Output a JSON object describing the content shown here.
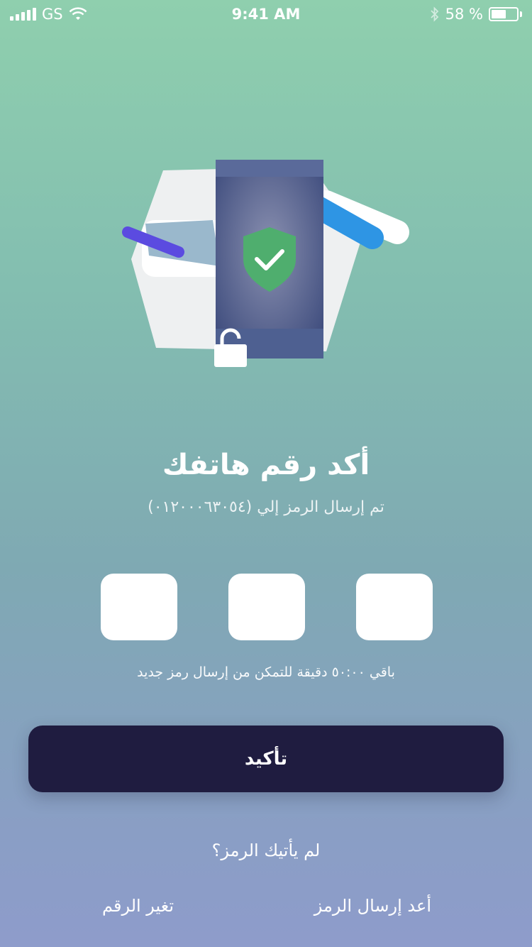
{
  "status_bar": {
    "carrier": "GS",
    "time": "9:41 AM",
    "battery_text": "58 %",
    "battery_level": 0.58
  },
  "illustration": {
    "icons": [
      "phone-icon",
      "shield-check-icon",
      "padlock-icon",
      "envelope-icon"
    ],
    "colors": {
      "phone": "#4a5a8c",
      "shield": "#4fae6e",
      "accent_purple": "#5b4be0",
      "accent_blue": "#2e95e4"
    }
  },
  "main": {
    "title": "أكد رقم هاتفك",
    "subtitle": "تم إرسال الرمز إلي (٠١٢٠٠٠٦٣٠٥٤)",
    "code_boxes": [
      "",
      "",
      ""
    ],
    "timer_text": "باقي ٥٠:٠٠ دقيقة للتمكن من إرسال رمز جديد",
    "confirm_label": "تأكيد"
  },
  "footer": {
    "no_code_text": "لم يأتيك الرمز؟",
    "resend_label": "أعد إرسال الرمز",
    "change_number_label": "تغير الرقم"
  },
  "colors": {
    "button_bg": "#1f1c40",
    "bg_top": "#8fcfae",
    "bg_bottom": "#8e9ccb"
  }
}
